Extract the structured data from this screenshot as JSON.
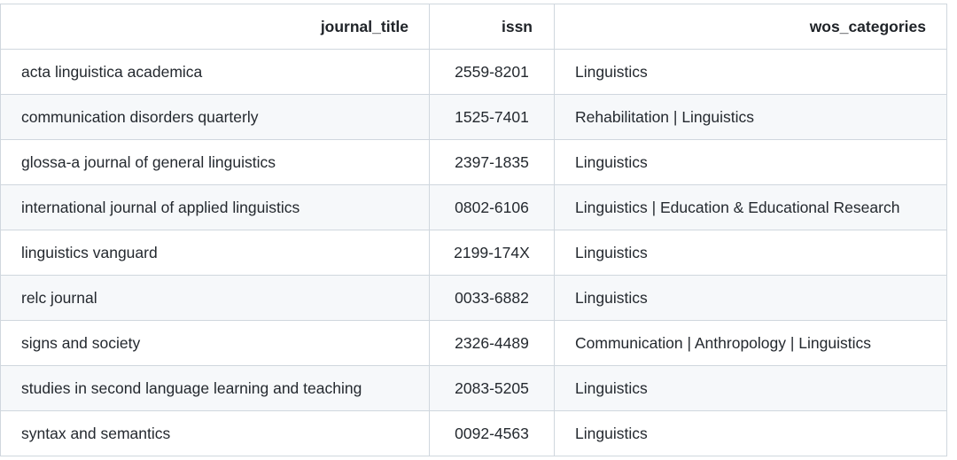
{
  "table": {
    "headers": {
      "journal_title": "journal_title",
      "issn": "issn",
      "wos_categories": "wos_categories"
    },
    "rows": [
      {
        "journal_title": "acta linguistica academica",
        "issn": "2559-8201",
        "wos_categories": "Linguistics"
      },
      {
        "journal_title": "communication disorders quarterly",
        "issn": "1525-7401",
        "wos_categories": "Rehabilitation | Linguistics"
      },
      {
        "journal_title": "glossa-a journal of general linguistics",
        "issn": "2397-1835",
        "wos_categories": "Linguistics"
      },
      {
        "journal_title": "international journal of applied linguistics",
        "issn": "0802-6106",
        "wos_categories": "Linguistics | Education & Educational Research"
      },
      {
        "journal_title": "linguistics vanguard",
        "issn": "2199-174X",
        "wos_categories": "Linguistics"
      },
      {
        "journal_title": "relc journal",
        "issn": "0033-6882",
        "wos_categories": "Linguistics"
      },
      {
        "journal_title": "signs and society",
        "issn": "2326-4489",
        "wos_categories": "Communication | Anthropology | Linguistics"
      },
      {
        "journal_title": "studies in second language learning and teaching",
        "issn": "2083-5205",
        "wos_categories": "Linguistics"
      },
      {
        "journal_title": "syntax and semantics",
        "issn": "0092-4563",
        "wos_categories": "Linguistics"
      }
    ]
  }
}
